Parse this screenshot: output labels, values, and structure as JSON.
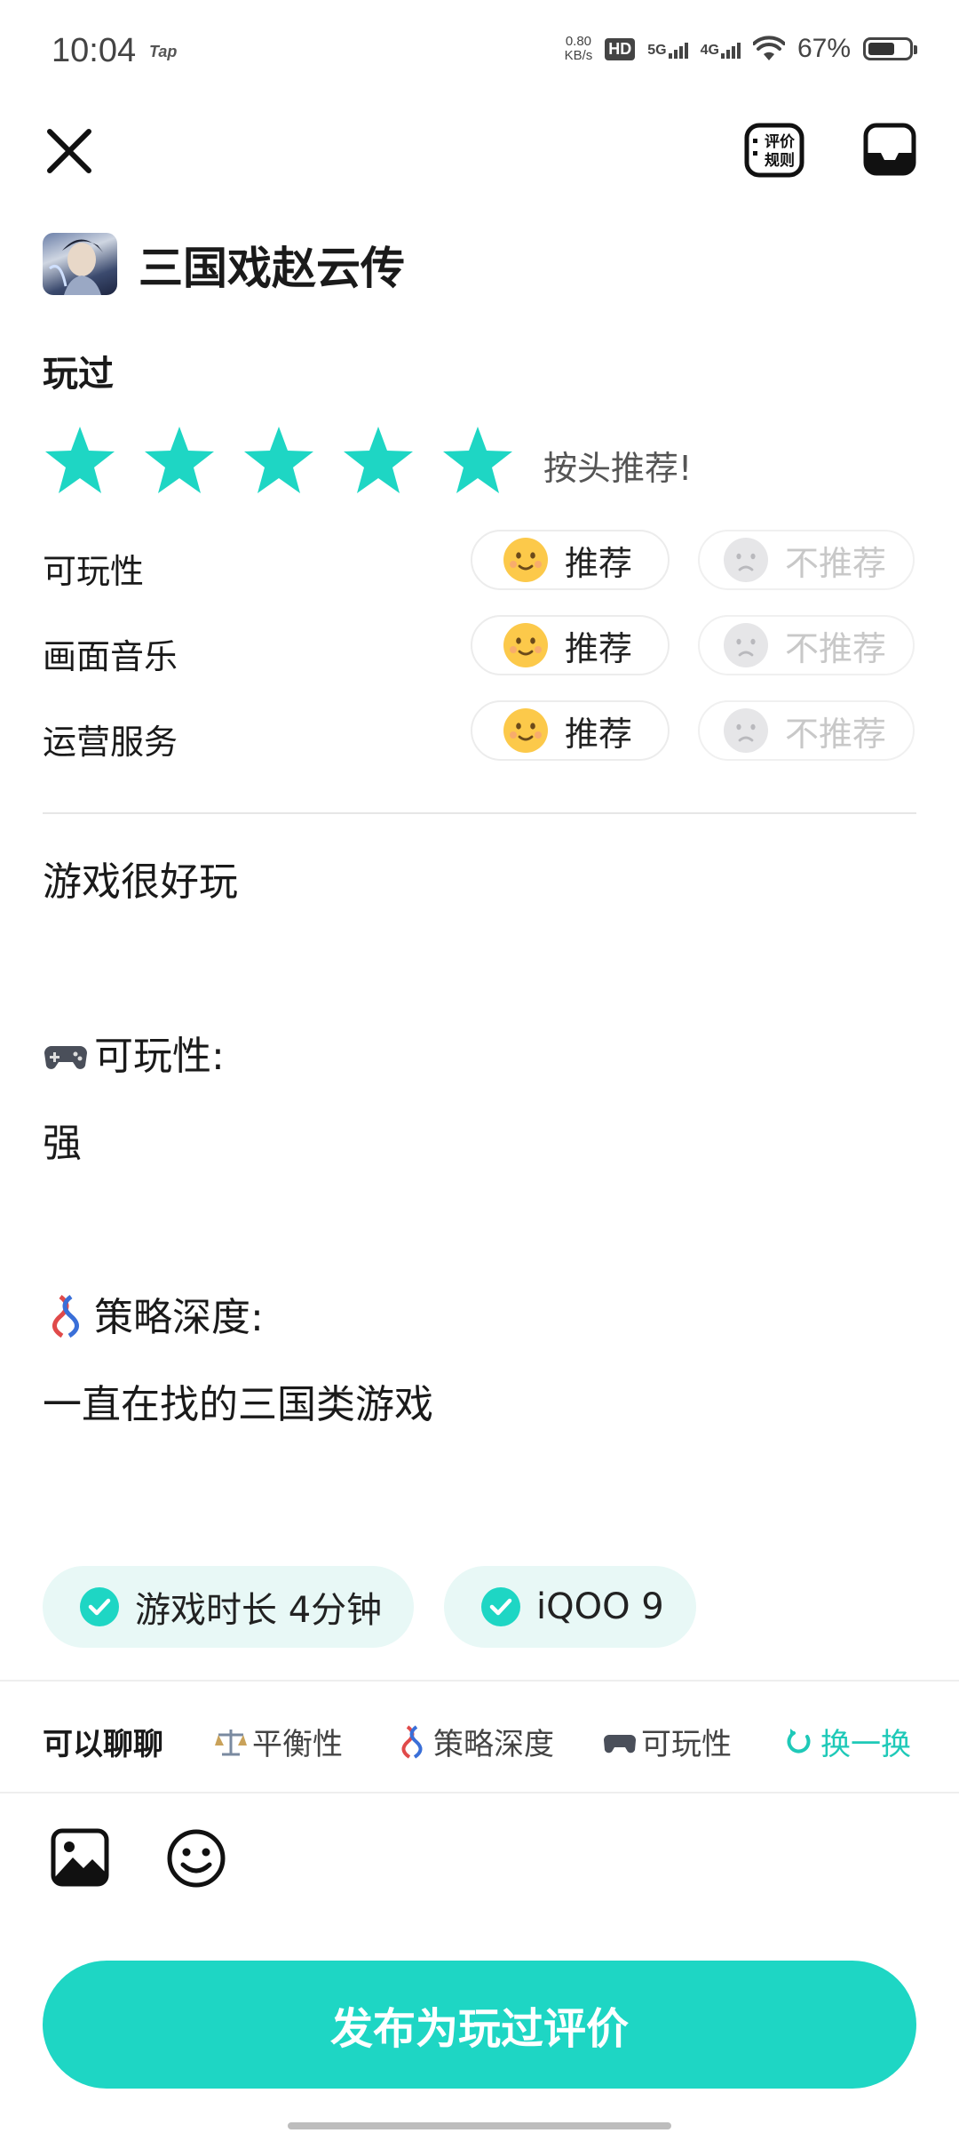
{
  "status_bar": {
    "time": "10:04",
    "app_logo": "Tap",
    "net_speed_value": "0.80",
    "net_speed_unit": "KB/s",
    "hd_badge": "HD",
    "sim1": "5G",
    "sim2": "4G",
    "battery_text": "67%",
    "battery_level": 0.67
  },
  "top_bar": {
    "rules_label_line1": "评价",
    "rules_label_line2": "规则"
  },
  "game": {
    "title": "三国戏赵云传"
  },
  "rating": {
    "section_label": "玩过",
    "stars": 5,
    "max_stars": 5,
    "star_color": "#1ed6c4",
    "text": "按头推荐!"
  },
  "aspects": [
    {
      "label": "可玩性",
      "recommend": "推荐",
      "not_recommend": "不推荐"
    },
    {
      "label": "画面音乐",
      "recommend": "推荐",
      "not_recommend": "不推荐"
    },
    {
      "label": "运营服务",
      "recommend": "推荐",
      "not_recommend": "不推荐"
    }
  ],
  "review": {
    "line1": "游戏很好玩",
    "section1_title": "可玩性:",
    "section1_icon": "gamepad-icon",
    "section1_text": "强",
    "section2_title": "策略深度:",
    "section2_icon": "strategy-knot-icon",
    "section2_text": "一直在找的三国类游戏"
  },
  "tags": [
    {
      "label": "游戏时长 4分钟"
    },
    {
      "label": "iQOO 9"
    }
  ],
  "chat": {
    "title": "可以聊聊",
    "topics": [
      {
        "label": "平衡性",
        "icon": "scale-icon"
      },
      {
        "label": "策略深度",
        "icon": "strategy-knot-icon"
      },
      {
        "label": "可玩性",
        "icon": "gamepad-icon"
      }
    ],
    "refresh_label": "换一换"
  },
  "publish_label": "发布为玩过评价",
  "colors": {
    "accent": "#1ed6c4",
    "accent_text": "#1fc9b8",
    "tag_bg": "#e8f8f6"
  }
}
